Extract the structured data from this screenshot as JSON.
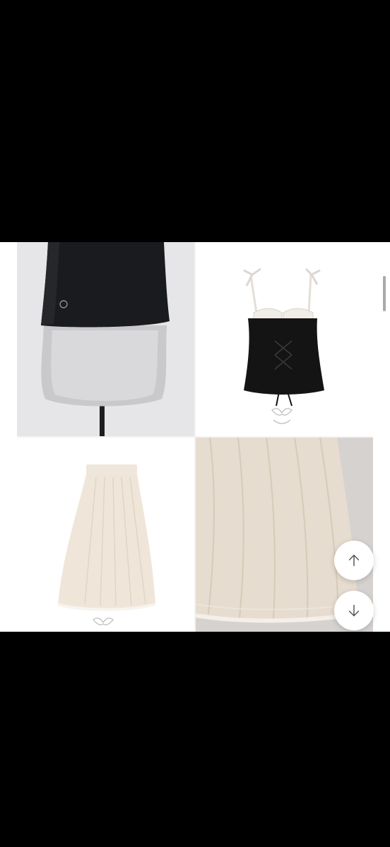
{
  "gallery": {
    "images": [
      {
        "name": "product-image-black-top-mannequin"
      },
      {
        "name": "product-image-black-corset-top"
      },
      {
        "name": "product-image-cream-skirt"
      },
      {
        "name": "product-image-skirt-detail"
      }
    ]
  },
  "controls": {
    "scroll_up_icon": "arrow-up-icon",
    "scroll_down_icon": "arrow-down-icon"
  },
  "colors": {
    "background": "#000000",
    "panel": "#ffffff",
    "button": "#ffffff"
  }
}
